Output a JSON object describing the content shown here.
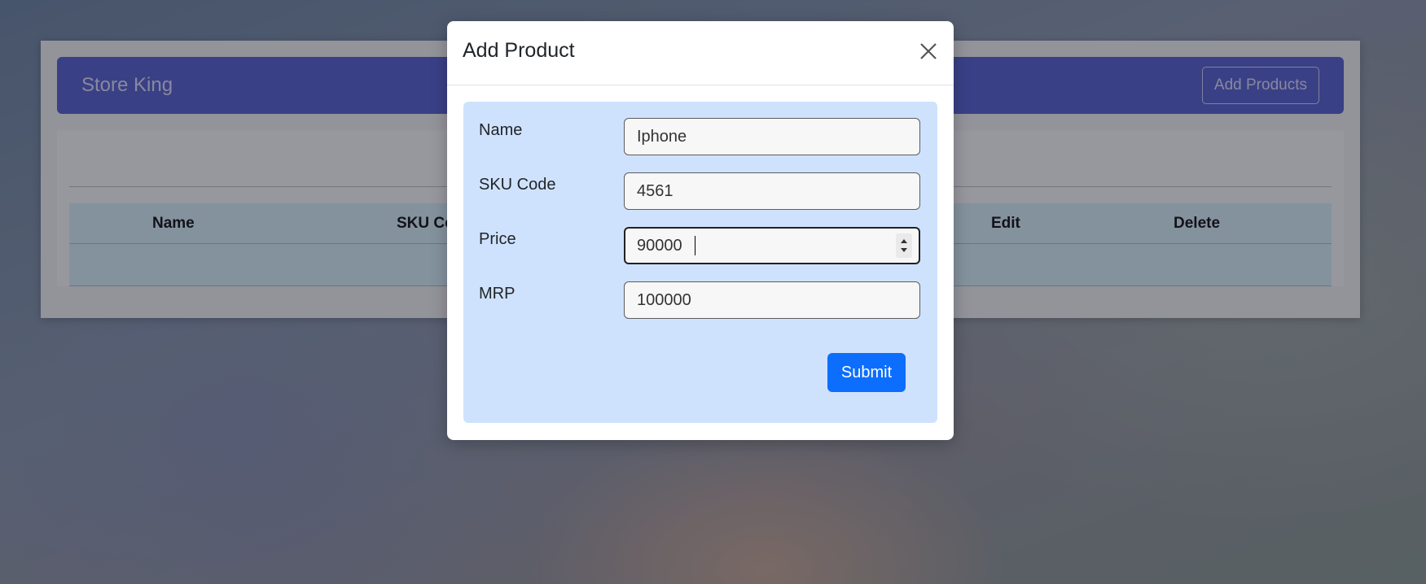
{
  "navbar": {
    "brand": "Store King",
    "add_products_label": "Add Products"
  },
  "table": {
    "columns": [
      "Name",
      "SKU Code",
      "Edit",
      "Delete"
    ]
  },
  "modal": {
    "title": "Add Product",
    "close_icon": "close-icon",
    "fields": [
      {
        "label": "Name",
        "value": "Iphone"
      },
      {
        "label": "SKU Code",
        "value": "4561"
      },
      {
        "label": "Price",
        "value": "90000"
      },
      {
        "label": "MRP",
        "value": "100000"
      }
    ],
    "submit_label": "Submit"
  },
  "colors": {
    "navbar": "#4a55c6",
    "modal_body": "#cfe2fd",
    "submit": "#0d6efd",
    "table_header": "#cfe9f2"
  }
}
